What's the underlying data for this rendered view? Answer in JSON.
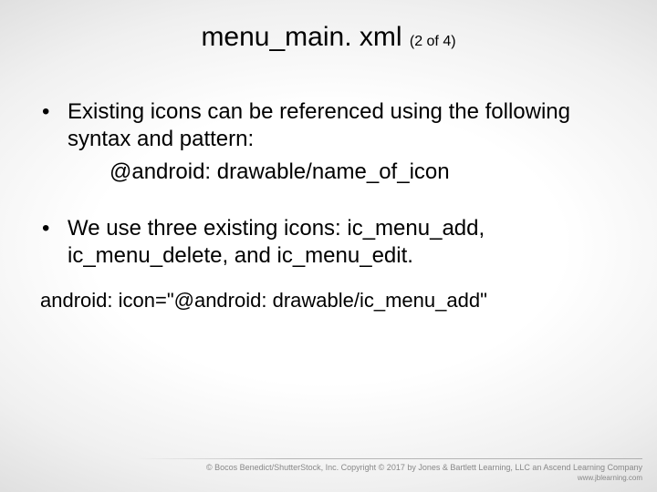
{
  "title": {
    "main": "menu_main. xml ",
    "sub": "(2 of 4)"
  },
  "bullets": [
    {
      "text": "Existing icons can be referenced using the following syntax and pattern:",
      "sub": "@android: drawable/name_of_icon"
    },
    {
      "text": "We use three existing icons: ic_menu_add, ic_menu_delete, and ic_menu_edit."
    }
  ],
  "code_line": "android: icon=\"@android: drawable/ic_menu_add\"",
  "footer": {
    "line1": "© Bocos Benedict/ShutterStock, Inc. Copyright © 2017 by Jones & Bartlett Learning, LLC an Ascend Learning Company",
    "line2": "www.jblearning.com"
  }
}
